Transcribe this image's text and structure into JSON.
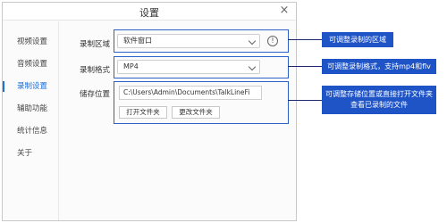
{
  "window": {
    "title": "设置",
    "close": "×"
  },
  "sidebar": {
    "items": [
      {
        "label": "视频设置"
      },
      {
        "label": "音频设置"
      },
      {
        "label": "录制设置",
        "active": true
      },
      {
        "label": "辅助功能"
      },
      {
        "label": "统计信息"
      },
      {
        "label": "关于"
      }
    ]
  },
  "record_area": {
    "label": "录制区域",
    "value": "软件窗口",
    "info_glyph": "!"
  },
  "record_format": {
    "label": "录制格式",
    "value": "MP4"
  },
  "storage": {
    "label": "储存位置",
    "path": "C:\\Users\\Admin\\Documents\\TalkLineFi",
    "open_folder": "打开文件夹",
    "change_folder": "更改文件夹"
  },
  "annotations": [
    {
      "text": "可调整录制的区域"
    },
    {
      "text": "可调整录制格式，支持mp4和flv"
    },
    {
      "text": "可调整存储位置或直接打开文件夹查看已录制的文件"
    }
  ],
  "colors": {
    "accent": "#1a6fe0",
    "callout_bg": "#1f54c6",
    "frame": "#2b62c9"
  }
}
